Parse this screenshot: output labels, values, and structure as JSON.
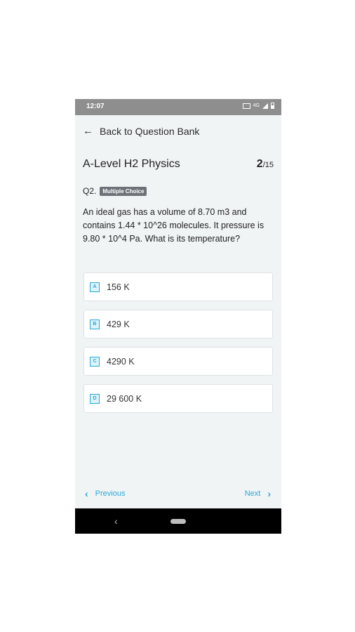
{
  "status_bar": {
    "time": "12:07",
    "network": "4G"
  },
  "header": {
    "back_label": "Back to Question Bank"
  },
  "title": {
    "text": "A-Level H2 Physics",
    "current": "2",
    "total": "/15"
  },
  "question": {
    "number": "Q2.",
    "type_badge": "Multiple Choice",
    "text": "An ideal gas has a volume of 8.70 m3 and contains 1.44 * 10^26 molecules. It pressure is 9.80 * 10^4 Pa. What is its temperature?"
  },
  "options": [
    {
      "letter": "A",
      "text": "156 K"
    },
    {
      "letter": "B",
      "text": "429 K"
    },
    {
      "letter": "C",
      "text": "4290 K"
    },
    {
      "letter": "D",
      "text": "29 600 K"
    }
  ],
  "navigation": {
    "previous": "Previous",
    "next": "Next"
  },
  "colors": {
    "accent": "#2aa8d8",
    "badge": "#6e7178",
    "background": "#f1f4f5"
  }
}
